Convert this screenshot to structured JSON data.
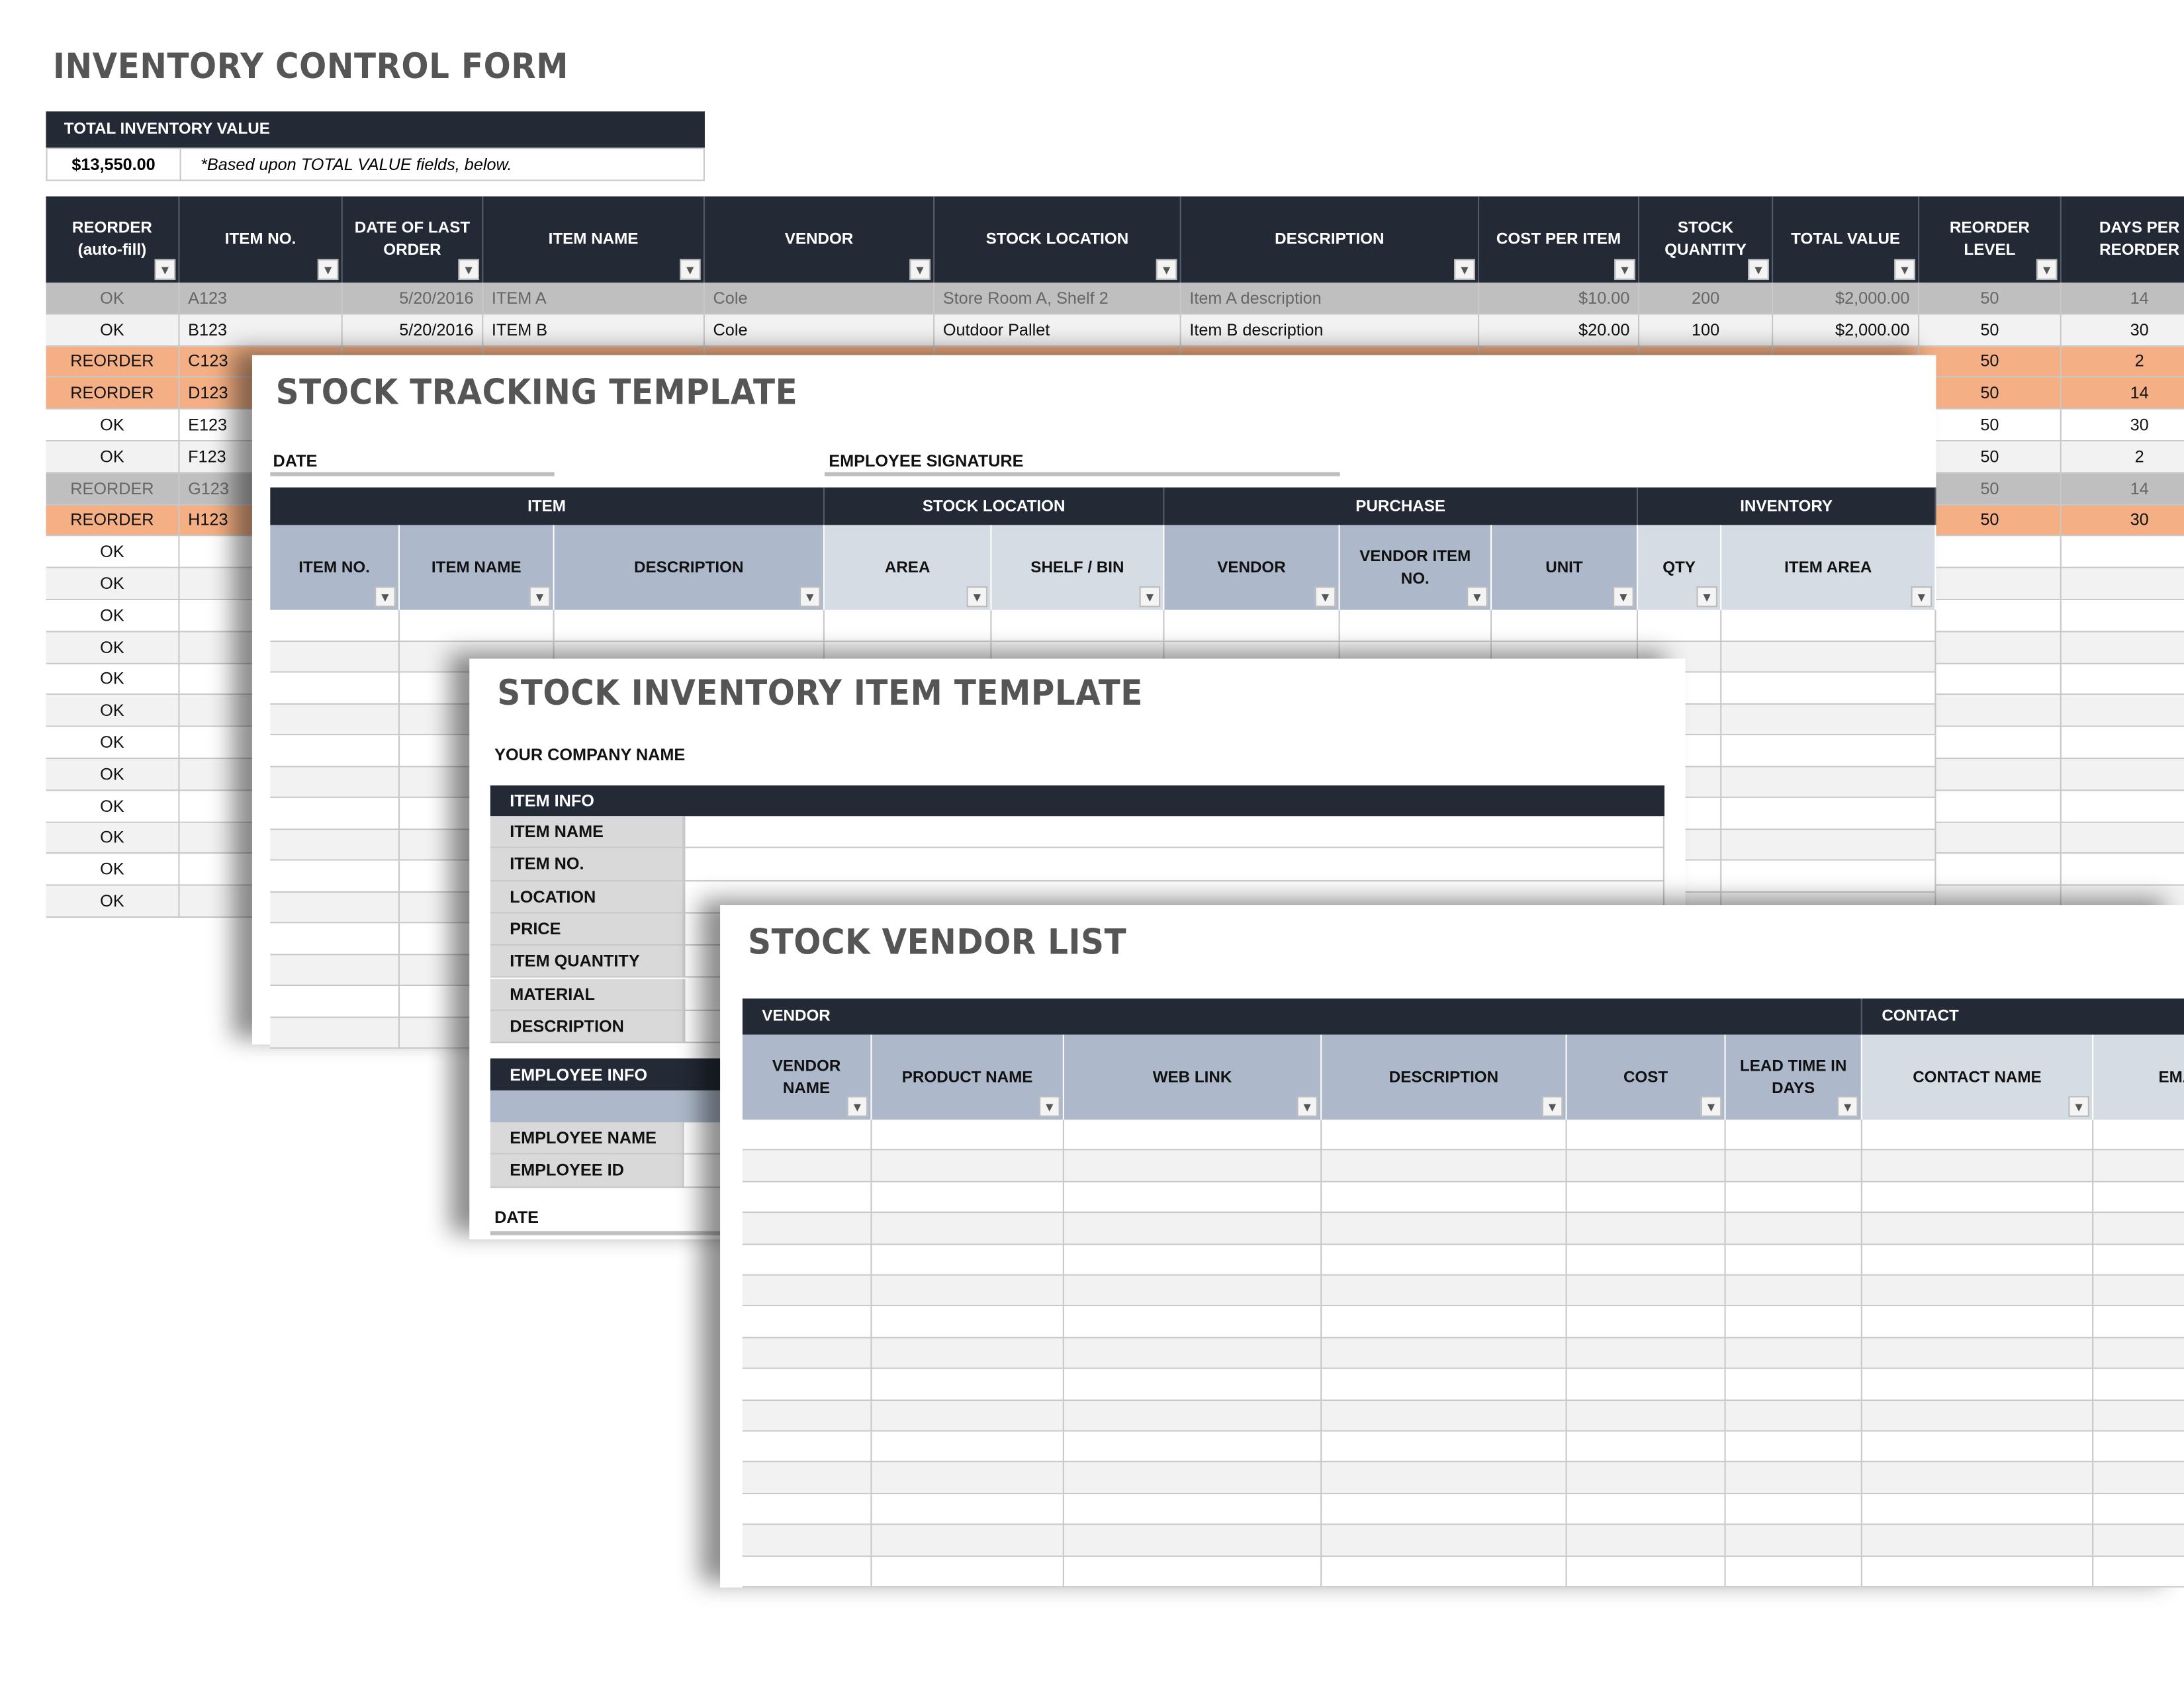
{
  "inventory_control": {
    "title": "INVENTORY CONTROL FORM",
    "total_label": "TOTAL INVENTORY VALUE",
    "total_value": "$13,550.00",
    "total_note": "*Based upon TOTAL VALUE fields, below.",
    "columns": [
      "REORDER (auto-fill)",
      "ITEM NO.",
      "DATE OF LAST ORDER",
      "ITEM NAME",
      "VENDOR",
      "STOCK LOCATION",
      "DESCRIPTION",
      "COST PER ITEM",
      "STOCK QUANTITY",
      "TOTAL VALUE",
      "REORDER LEVEL",
      "DAYS PER REORDER"
    ],
    "rows": [
      {
        "style": "gray",
        "cells": [
          "OK",
          "A123",
          "5/20/2016",
          "ITEM A",
          "Cole",
          "Store Room A, Shelf 2",
          "Item A description",
          "$10.00",
          "200",
          "$2,000.00",
          "50",
          "14"
        ]
      },
      {
        "style": "light",
        "cells": [
          "OK",
          "B123",
          "5/20/2016",
          "ITEM B",
          "Cole",
          "Outdoor Pallet",
          "Item B description",
          "$20.00",
          "100",
          "$2,000.00",
          "50",
          "30"
        ]
      },
      {
        "style": "orange",
        "cells": [
          "REORDER",
          "C123",
          "",
          "",
          "",
          "",
          "",
          "",
          "",
          "",
          "50",
          "2"
        ]
      },
      {
        "style": "orange",
        "cells": [
          "REORDER",
          "D123",
          "",
          "",
          "",
          "",
          "",
          "",
          "",
          "",
          "50",
          "14"
        ]
      },
      {
        "style": "white",
        "cells": [
          "OK",
          "E123",
          "",
          "",
          "",
          "",
          "",
          "",
          "",
          "",
          "50",
          "30"
        ]
      },
      {
        "style": "light",
        "cells": [
          "OK",
          "F123",
          "",
          "",
          "",
          "",
          "",
          "",
          "",
          "",
          "50",
          "2"
        ]
      },
      {
        "style": "gray",
        "cells": [
          "REORDER",
          "G123",
          "",
          "",
          "",
          "",
          "",
          "",
          "",
          "",
          "50",
          "14"
        ]
      },
      {
        "style": "orange",
        "cells": [
          "REORDER",
          "H123",
          "",
          "",
          "",
          "",
          "",
          "",
          "",
          "",
          "50",
          "30"
        ]
      },
      {
        "style": "white",
        "cells": [
          "OK"
        ]
      },
      {
        "style": "light",
        "cells": [
          "OK"
        ]
      },
      {
        "style": "white",
        "cells": [
          "OK"
        ]
      },
      {
        "style": "light",
        "cells": [
          "OK"
        ]
      },
      {
        "style": "white",
        "cells": [
          "OK"
        ]
      },
      {
        "style": "light",
        "cells": [
          "OK"
        ]
      },
      {
        "style": "white",
        "cells": [
          "OK"
        ]
      },
      {
        "style": "light",
        "cells": [
          "OK"
        ]
      },
      {
        "style": "white",
        "cells": [
          "OK"
        ]
      },
      {
        "style": "light",
        "cells": [
          "OK"
        ]
      },
      {
        "style": "white",
        "cells": [
          "OK"
        ]
      },
      {
        "style": "light",
        "cells": [
          "OK"
        ]
      }
    ]
  },
  "stock_tracking": {
    "title": "STOCK TRACKING TEMPLATE",
    "date_label": "DATE",
    "signature_label": "EMPLOYEE SIGNATURE",
    "groups": [
      "ITEM",
      "STOCK LOCATION",
      "PURCHASE",
      "INVENTORY"
    ],
    "columns": [
      "ITEM NO.",
      "ITEM NAME",
      "DESCRIPTION",
      "AREA",
      "SHELF / BIN",
      "VENDOR",
      "VENDOR ITEM NO.",
      "UNIT",
      "QTY",
      "ITEM AREA"
    ]
  },
  "stock_item": {
    "title": "STOCK INVENTORY ITEM TEMPLATE",
    "company": "YOUR COMPANY NAME",
    "item_info_label": "ITEM INFO",
    "item_fields": [
      "ITEM NAME",
      "ITEM NO.",
      "LOCATION",
      "PRICE",
      "ITEM QUANTITY",
      "MATERIAL",
      "DESCRIPTION"
    ],
    "employee_info_label": "EMPLOYEE INFO",
    "employee_fields": [
      "EMPLOYEE NAME",
      "EMPLOYEE ID"
    ],
    "date_label": "DATE"
  },
  "vendor_list": {
    "title": "STOCK VENDOR LIST",
    "groups": [
      "VENDOR",
      "CONTACT"
    ],
    "columns": [
      "VENDOR NAME",
      "PRODUCT NAME",
      "WEB LINK",
      "DESCRIPTION",
      "COST",
      "LEAD TIME IN DAYS",
      "CONTACT NAME",
      "EMA"
    ]
  },
  "colors": {
    "header_dark": "#232a36",
    "header_blue": "#adb9ca",
    "header_light": "#d6dce4",
    "reorder_orange": "#f4b084",
    "row_gray": "#bfbfbf",
    "row_light": "#f2f2f2",
    "title_gray": "#555555"
  }
}
